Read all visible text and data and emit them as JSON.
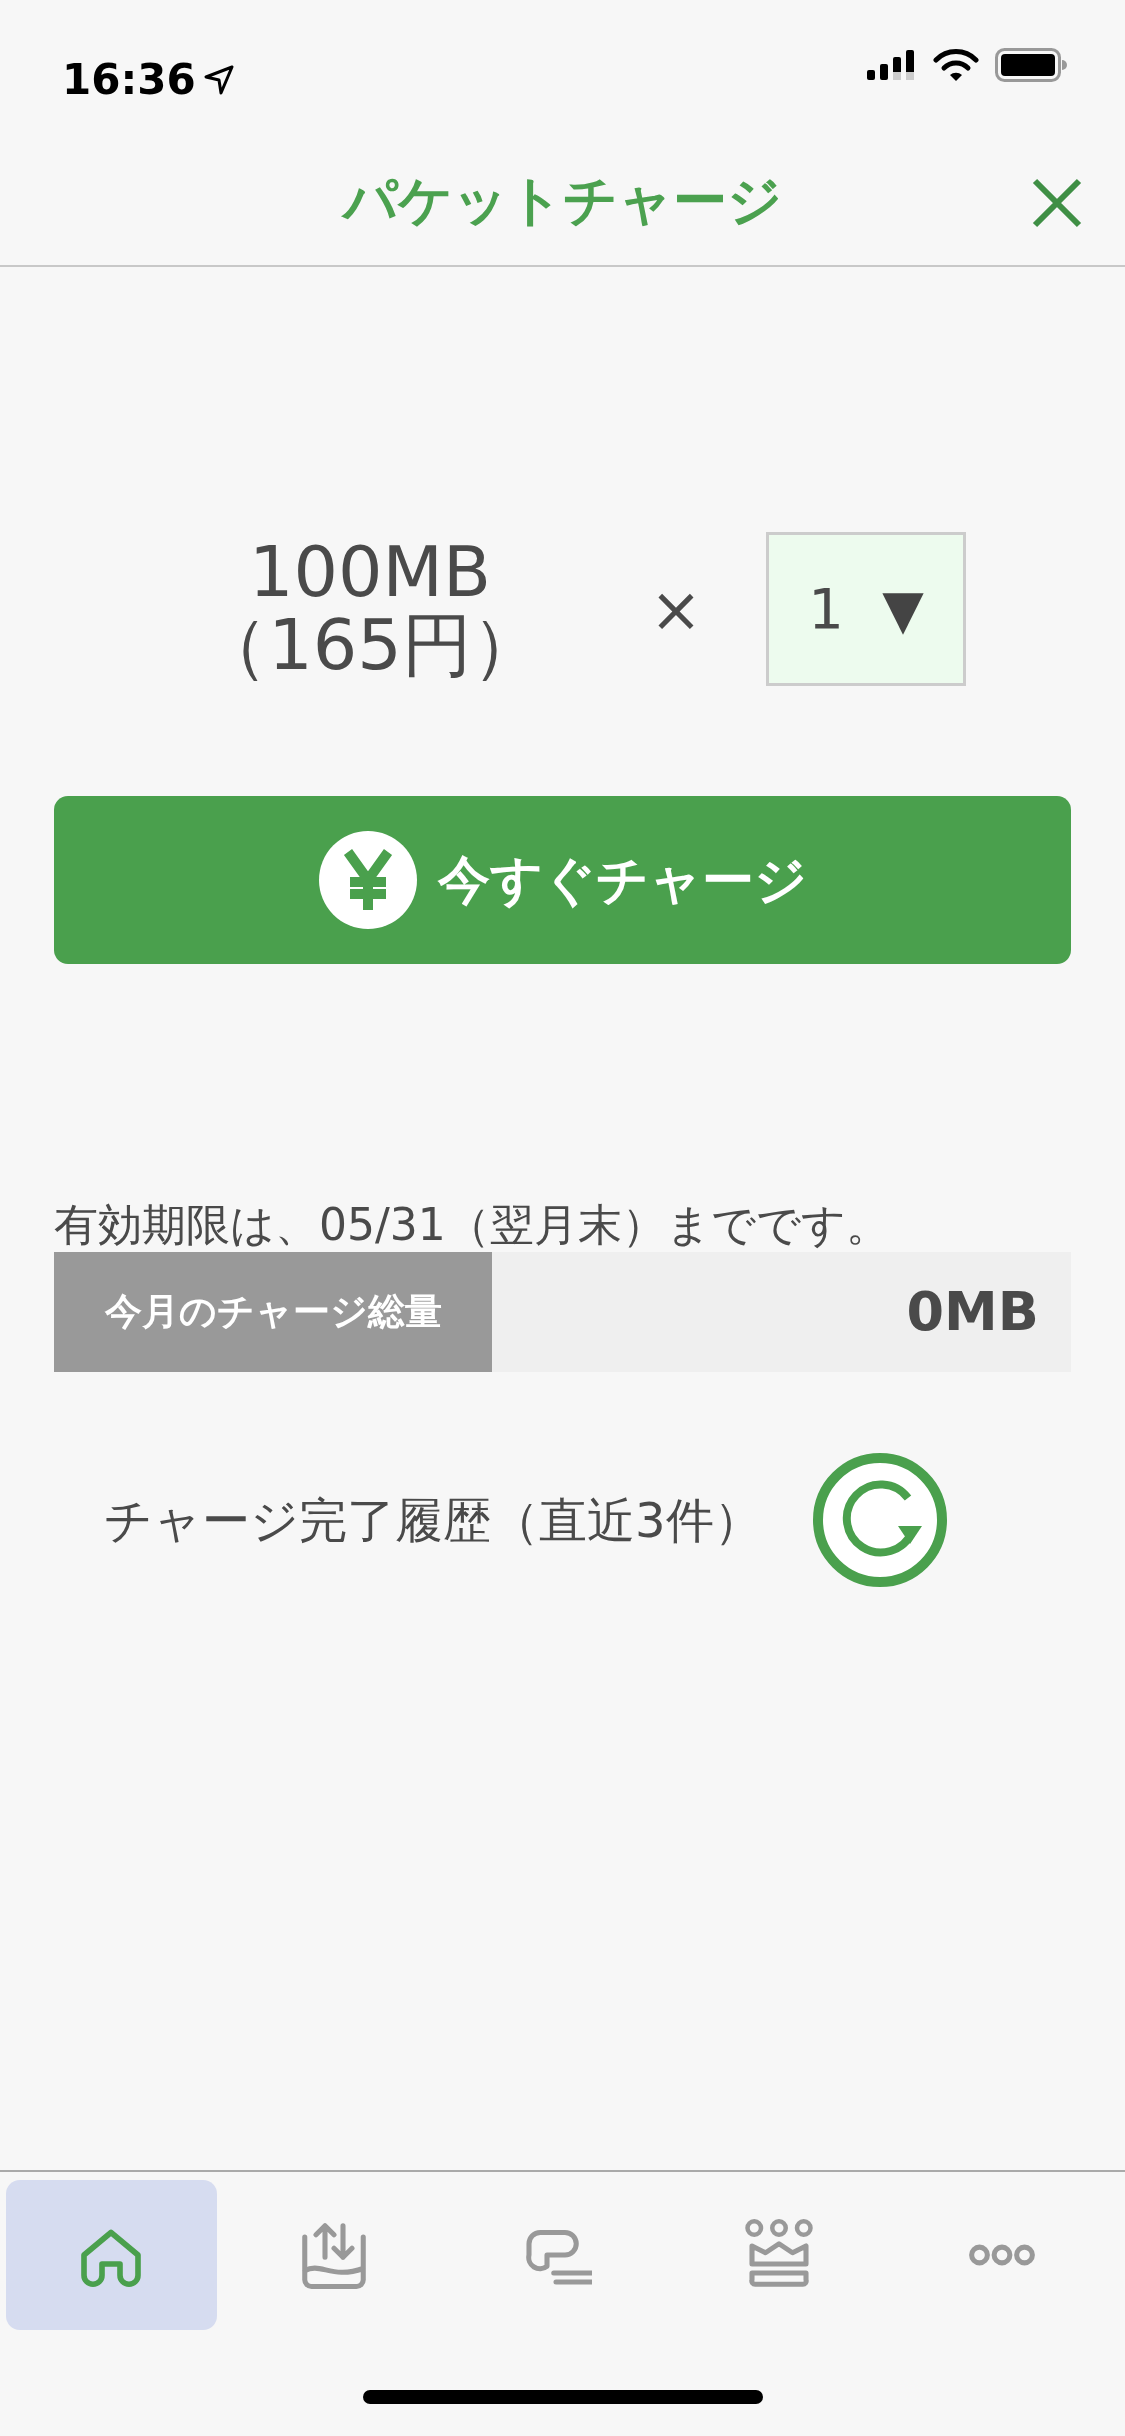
{
  "status_bar": {
    "time": "16:36"
  },
  "header": {
    "title": "パケットチャージ"
  },
  "plan": {
    "size": "100MB",
    "price": "（165円）",
    "multiplier": "×",
    "quantity": "1",
    "dropdown_arrow": "▼"
  },
  "charge_button": {
    "label": "今すぐチャージ"
  },
  "expiry": "有効期限は、05/31（翌月末）までです。",
  "monthly_total": {
    "label": "今月のチャージ総量",
    "value": "0MB"
  },
  "history": {
    "label": "チャージ完了履歴（直近3件）"
  },
  "tabs": [
    {
      "kind": "home",
      "selected": true
    },
    {
      "kind": "transfer",
      "selected": false
    },
    {
      "kind": "chat",
      "selected": false
    },
    {
      "kind": "crown",
      "selected": false
    },
    {
      "kind": "more",
      "selected": false
    }
  ]
}
